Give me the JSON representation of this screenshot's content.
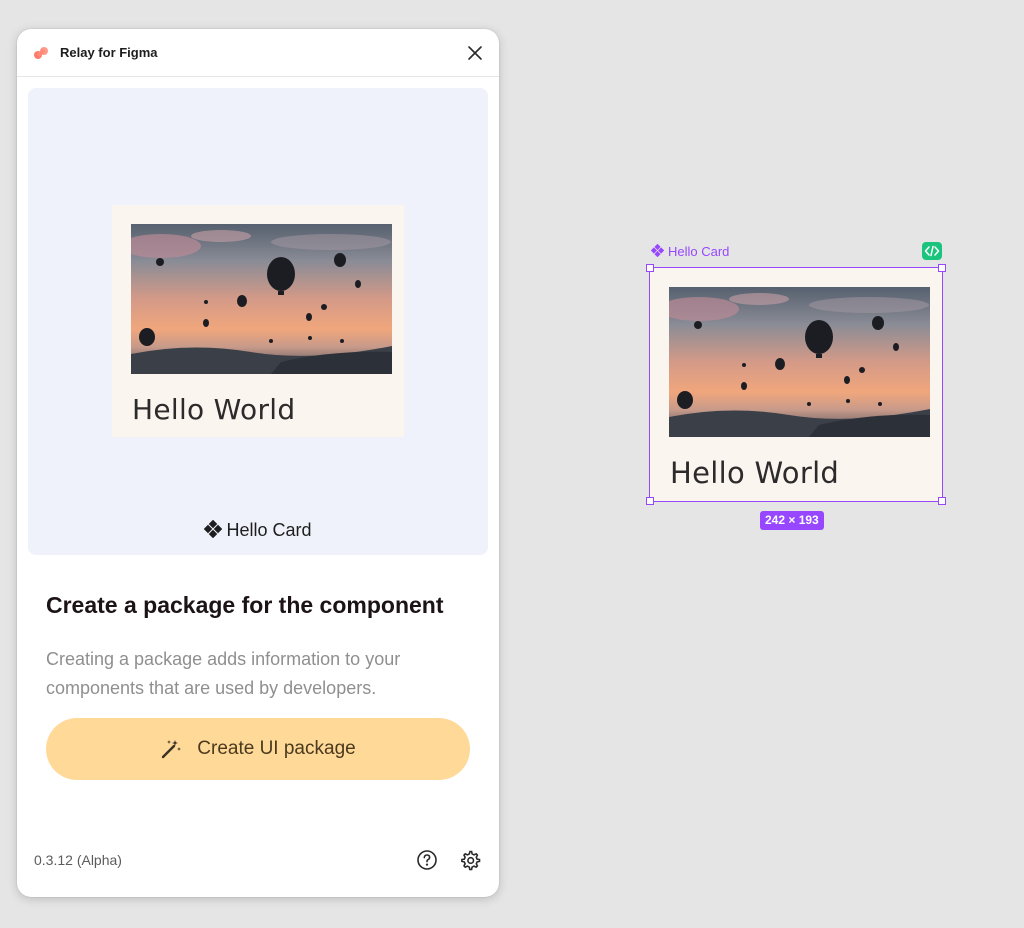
{
  "panel": {
    "title": "Relay for Figma",
    "preview": {
      "card_title": "Hello World",
      "component_name": "Hello Card"
    },
    "heading": "Create a package for the component",
    "description": "Creating a package adds information to your components that are used by developers.",
    "primary_button_label": "Create UI package",
    "version": "0.3.12 (Alpha)",
    "icons": {
      "logo": "relay-logo-icon",
      "close": "close-icon",
      "wand": "magic-wand-icon",
      "help": "help-circle-icon",
      "settings": "gear-icon",
      "component": "component-icon"
    }
  },
  "canvas": {
    "component_label": "Hello Card",
    "card_title": "Hello World",
    "size_badge": "242 × 193",
    "dev_badge_icon": "code-icon"
  },
  "colors": {
    "canvas_bg": "#e5e5e5",
    "preview_bg": "#eff2fa",
    "card_bg": "#fbf5f0",
    "button_bg": "#ffd998",
    "selection": "#9747ff",
    "dev_badge": "#1bc47d"
  }
}
